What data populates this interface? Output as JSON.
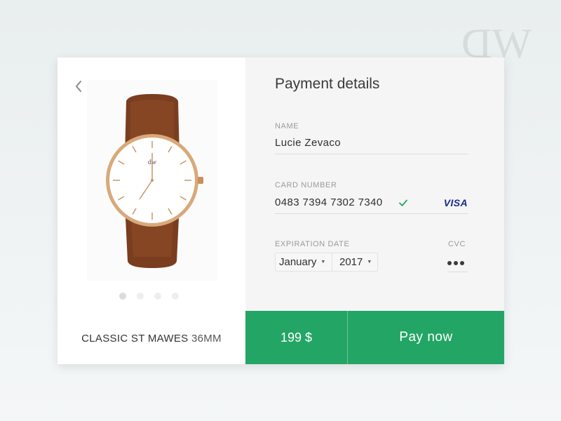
{
  "logo": {
    "text_d": "D",
    "text_w": "W"
  },
  "product": {
    "name": "CLASSIC ST MAWES",
    "size": "36MM",
    "carousel_total": 4,
    "carousel_active": 1
  },
  "payment": {
    "title": "Payment details",
    "name_label": "NAME",
    "name_value": "Lucie Zevaco",
    "card_label": "CARD NUMBER",
    "card_value": "0483 7394 7302 7340",
    "card_brand": "VISA",
    "expiration_label": "EXPIRATION DATE",
    "month": "January",
    "year": "2017",
    "cvc_label": "CVC"
  },
  "footer": {
    "price": "199 $",
    "pay_label": "Pay now"
  },
  "colors": {
    "accent": "#23a566",
    "check": "#23a566",
    "visa": "#1a2b88"
  }
}
